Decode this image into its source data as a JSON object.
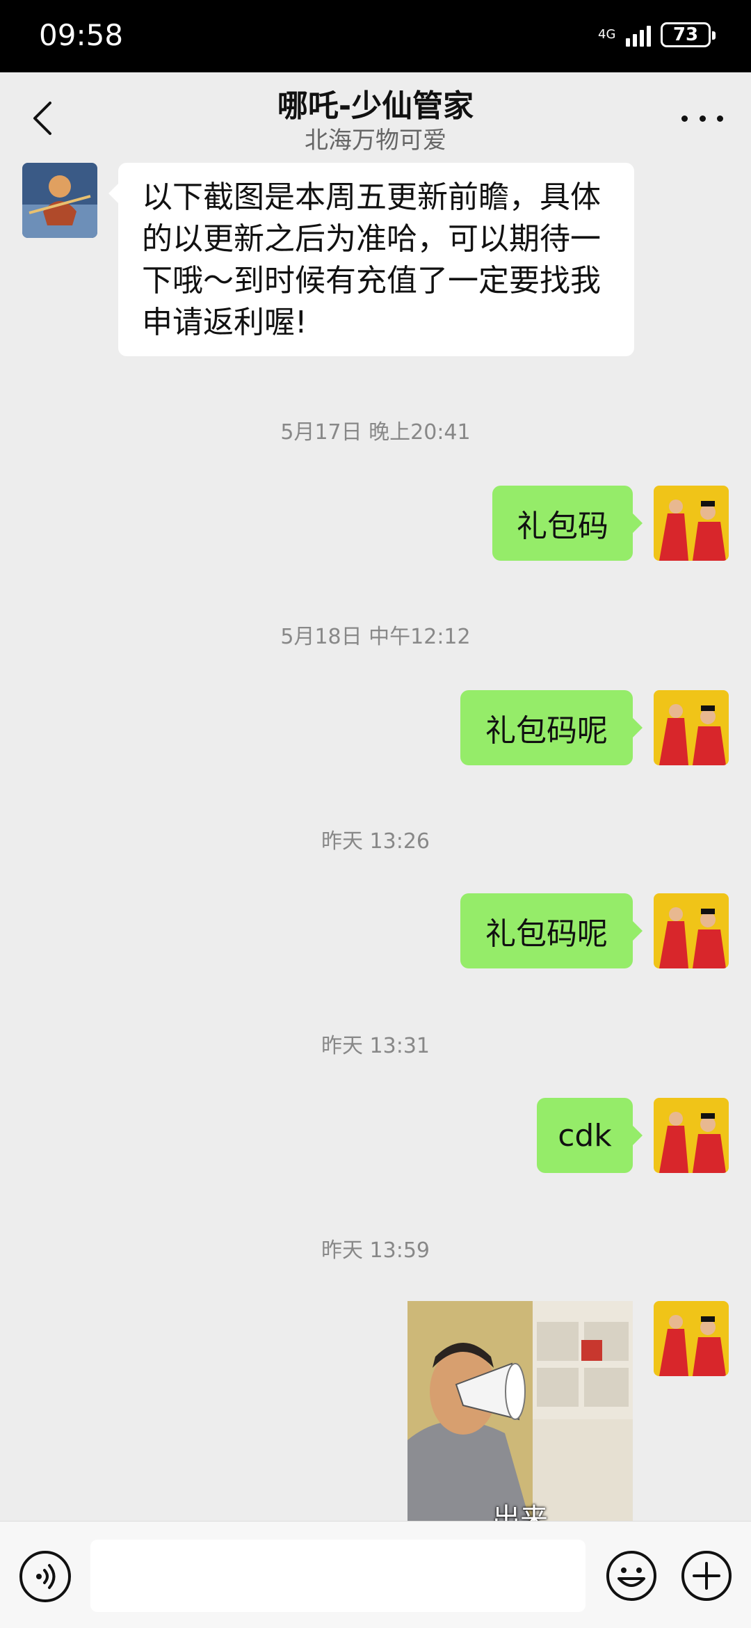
{
  "status": {
    "time": "09:58",
    "network": "4G",
    "battery": "73"
  },
  "header": {
    "title": "哪吒-少仙管家",
    "subtitle": "北海万物可爱"
  },
  "messages": {
    "first": {
      "lines": [
        "以下截图是本周五更新前瞻，具体",
        "的以更新之后为准哈，可以期待一",
        "下哦～到时候有充值了一定要找我",
        "申请返利喔!"
      ]
    },
    "ts1": "5月17日 晚上20:41",
    "m1": "礼包码",
    "ts2": "5月18日 中午12:12",
    "m2": "礼包码呢",
    "ts3": "昨天 13:26",
    "m3": "礼包码呢",
    "ts4": "昨天 13:31",
    "m4": "cdk",
    "ts5": "昨天 13:59",
    "sticker_caption": "出来"
  },
  "icons": {
    "back": "chevron-left-icon",
    "more": "ellipsis-icon",
    "voice": "voice-icon",
    "emoji": "emoji-icon",
    "plus": "plus-icon"
  },
  "colors": {
    "self_bubble": "#95ec69",
    "other_bubble": "#ffffff",
    "background": "#ededed"
  }
}
